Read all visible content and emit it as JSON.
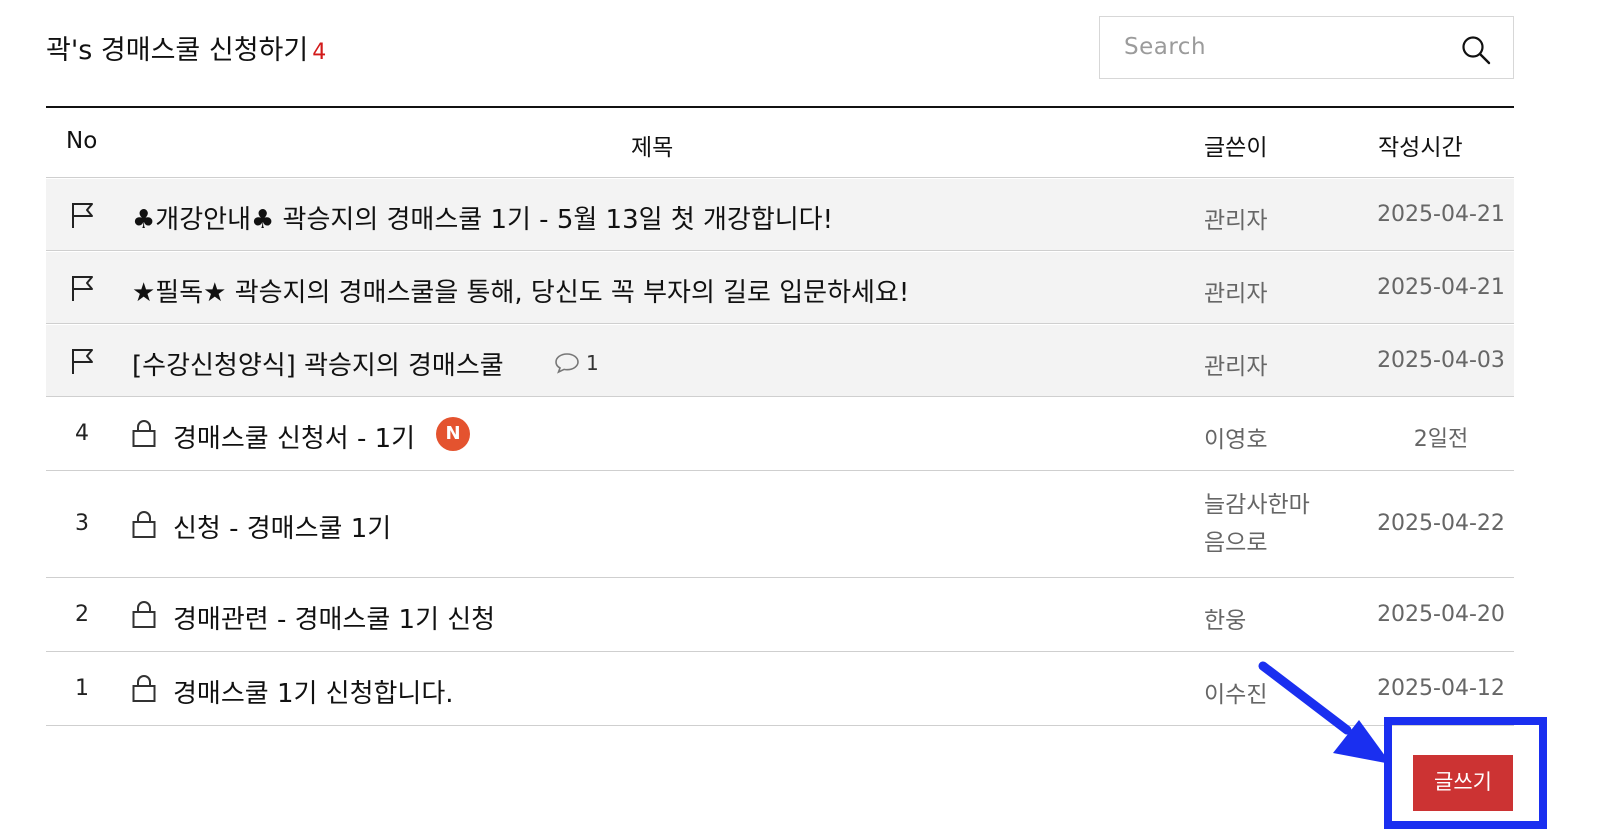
{
  "board": {
    "title": "곽's 경매스쿨 신청하기",
    "count": "4"
  },
  "search": {
    "placeholder": "Search"
  },
  "columns": {
    "no": "No",
    "title": "제목",
    "author": "글쓴이",
    "date": "작성시간"
  },
  "notices": [
    {
      "title": "♣개강안내♣ 곽승지의 경매스쿨 1기 - 5월 13일 첫 개강합니다!",
      "author": "관리자",
      "date": "2025-04-21"
    },
    {
      "title": "★필독★ 곽승지의 경매스쿨을 통해, 당신도 꼭 부자의 길로 입문하세요!",
      "author": "관리자",
      "date": "2025-04-21"
    },
    {
      "title": "[수강신청양식] 곽승지의 경매스쿨",
      "comments": "1",
      "author": "관리자",
      "date": "2025-04-03"
    }
  ],
  "posts": [
    {
      "no": "4",
      "title": "경매스쿨 신청서 - 1기",
      "badge": "N",
      "author": "이영호",
      "date": "2일전"
    },
    {
      "no": "3",
      "title": "신청 - 경매스쿨 1기",
      "author": "늘감사한마음으로",
      "date": "2025-04-22"
    },
    {
      "no": "2",
      "title": "경매관련 - 경매스쿨 1기 신청",
      "author": "한웅",
      "date": "2025-04-20"
    },
    {
      "no": "1",
      "title": "경매스쿨 1기 신청합니다.",
      "author": "이수진",
      "date": "2025-04-12"
    }
  ],
  "actions": {
    "write_label": "글쓰기"
  },
  "annotation": {
    "color": "#1a2ff0"
  }
}
